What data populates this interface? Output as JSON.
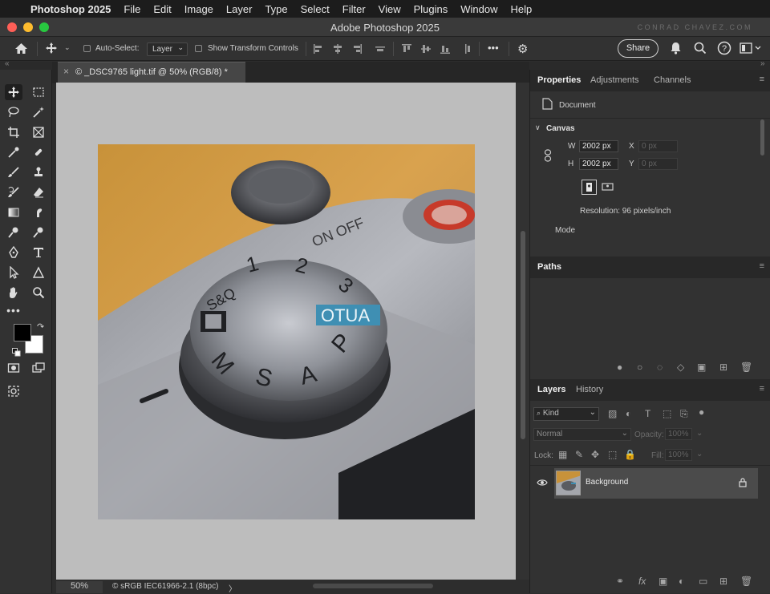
{
  "mac_menubar": {
    "apple": "",
    "app": "Photoshop 2025",
    "items": [
      "File",
      "Edit",
      "Image",
      "Layer",
      "Type",
      "Select",
      "Filter",
      "View",
      "Plugins",
      "Window",
      "Help"
    ]
  },
  "window": {
    "title": "Adobe Photoshop 2025",
    "watermark": "CONRAD CHAVEZ.COM"
  },
  "options": {
    "auto_select_label": "Auto-Select:",
    "auto_select_value": "Layer",
    "transform_label": "Show Transform Controls",
    "more": "•••",
    "share": "Share"
  },
  "document": {
    "tab": "© _DSC9765 light.tif @ 50% (RGB/8) *",
    "close": "×"
  },
  "status": {
    "zoom": "50%",
    "profile": "© sRGB IEC61966-2.1 (8bpc)",
    "arrow": "〉"
  },
  "properties_panel": {
    "tabs": [
      "Properties",
      "Adjustments",
      "Channels"
    ],
    "doc_label": "Document",
    "canvas_label": "Canvas",
    "w_label": "W",
    "w_value": "2002 px",
    "h_label": "H",
    "h_value": "2002 px",
    "x_label": "X",
    "x_value": "0 px",
    "y_label": "Y",
    "y_value": "0 px",
    "resolution": "Resolution: 96 pixels/inch",
    "mode": "Mode"
  },
  "paths_panel": {
    "title": "Paths"
  },
  "layers_panel": {
    "tabs": [
      "Layers",
      "History"
    ],
    "kind": "Kind",
    "blend": "Normal",
    "opacity_label": "Opacity:",
    "opacity_value": "100%",
    "lock_label": "Lock:",
    "fill_label": "Fill:",
    "fill_value": "100%",
    "layer_name": "Background"
  },
  "colors": {
    "accent": "#4aa3d8",
    "close": "#ff5f57",
    "minimize": "#febc2e",
    "maximize": "#28c840",
    "canvas_bg": "#bdbdbd"
  }
}
